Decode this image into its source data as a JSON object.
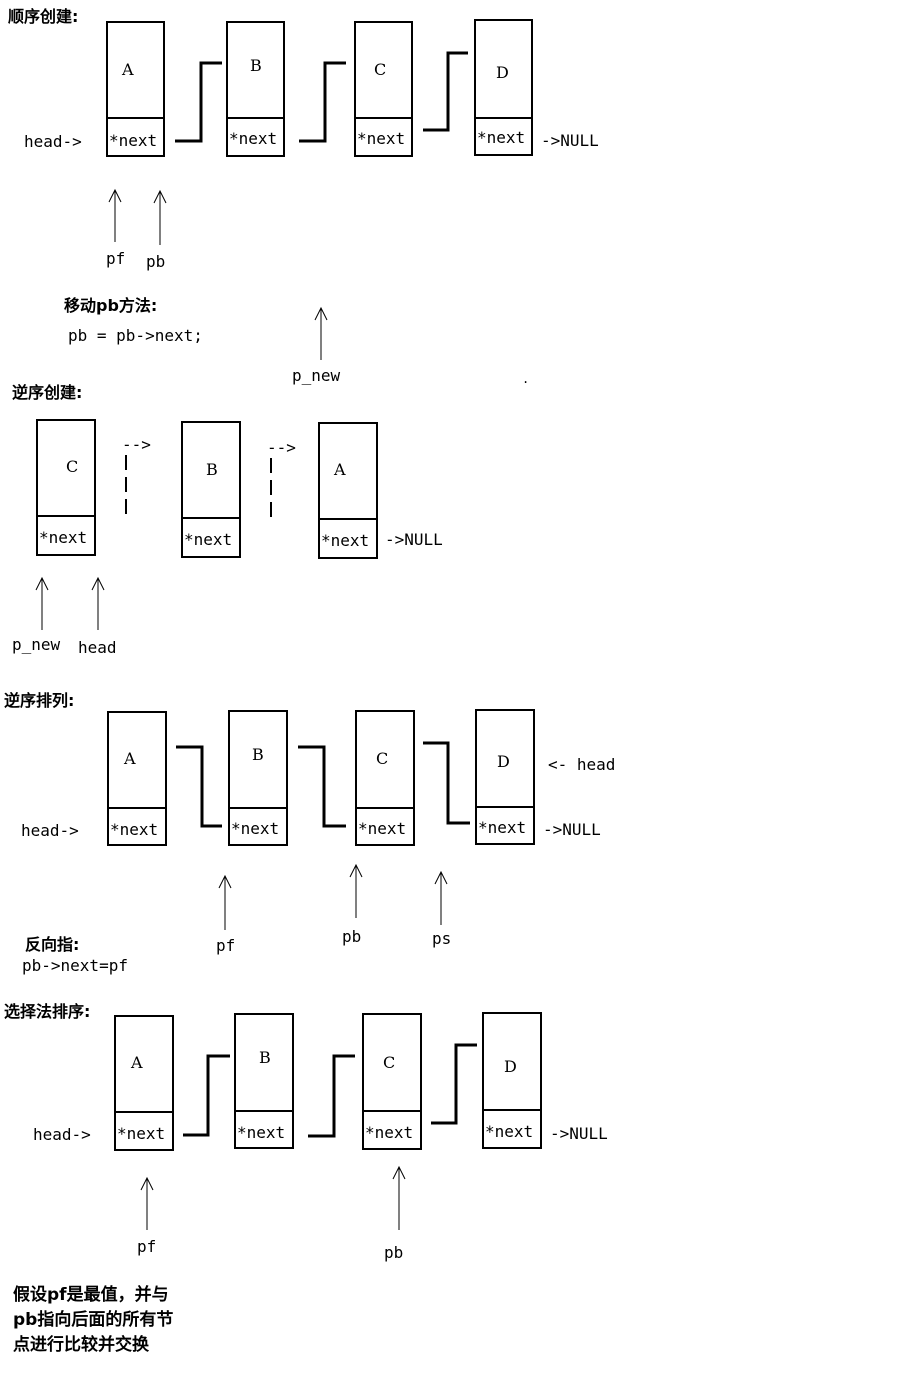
{
  "section_titles": {
    "sequential_create": "顺序创建:",
    "move_pb_method": "移动pb方法:",
    "reverse_create": "逆序创建:",
    "reverse_sort": "逆序排列:",
    "reverse_point": "反向指:",
    "selection_sort": "选择法排序:"
  },
  "code": {
    "move_pb": "pb = pb->next;",
    "reverse_point": "pb->next=pf"
  },
  "labels": {
    "head_arrow": "head->",
    "null_arrow": "->NULL",
    "next_field": "*next",
    "dash_arrow": "-->",
    "head_left_arrow": "<- head",
    "pf": "pf",
    "pb": "pb",
    "ps": "ps",
    "p_new": "p_new",
    "head": "head",
    "dot": "."
  },
  "nodes": {
    "sequential": [
      "A",
      "B",
      "C",
      "D"
    ],
    "reverse_create": [
      "C",
      "B",
      "A"
    ],
    "reverse_sort": [
      "A",
      "B",
      "C",
      "D"
    ],
    "selection": [
      "A",
      "B",
      "C",
      "D"
    ]
  },
  "note": [
    "假设pf是最值，并与",
    "pb指向后面的所有节",
    "点进行比较并交换"
  ]
}
